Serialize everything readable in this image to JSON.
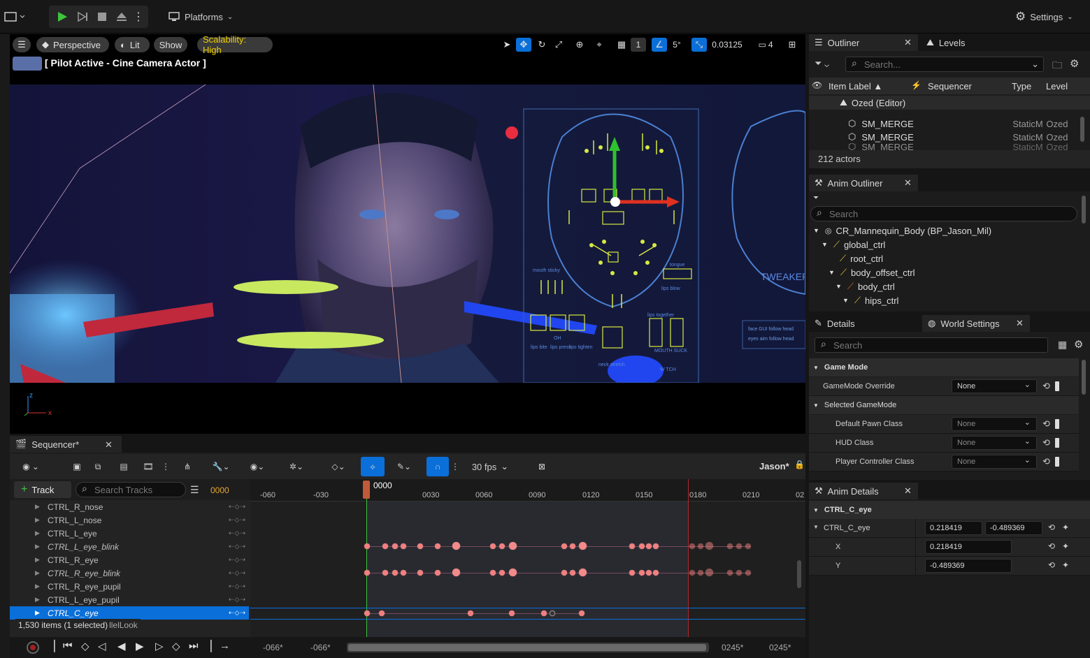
{
  "topbar": {
    "platforms_label": "Platforms",
    "settings_label": "Settings"
  },
  "viewport": {
    "perspective_label": "Perspective",
    "lit_label": "Lit",
    "show_label": "Show",
    "scalability_label": "Scalability: High",
    "grid_value": "1",
    "angle_value": "5°",
    "scale_value": "0.03125",
    "camera_speed": "4",
    "pilot_label": "[ Pilot Active - Cine Camera Actor ]",
    "axis_z": "z",
    "axis_x": "x",
    "board_labels": {
      "mouth_sticky": "mouth sticky",
      "lips_blow": "lips blow",
      "oh": "OH",
      "lips_together": "lips together",
      "mouth_suck": "MOUTH SUCK",
      "lips_bite": "lips bite",
      "lips_press": "lips press",
      "lips_tighten": "lips tighten",
      "neck_stretch": "neck stretch",
      "w_tch": "W TCH",
      "tongue": "tongue",
      "tweaker": "TWEAKER",
      "face_gui_follow": "face GUI follow head",
      "eyes_aim_follow": "eyes aim follow head"
    }
  },
  "outliner": {
    "tab_label": "Outliner",
    "levels_tab": "Levels",
    "search_placeholder": "Search...",
    "columns": [
      "Item Label ▲",
      "Sequencer",
      "Type",
      "Level"
    ],
    "root_item": "Ozed (Editor)",
    "items": [
      {
        "label": "SM_MERGE",
        "type": "StaticM",
        "level": "Ozed"
      },
      {
        "label": "SM_MERGE",
        "type": "StaticM",
        "level": "Ozed"
      },
      {
        "label": "SM_MERGE",
        "type": "StaticM",
        "level": "Ozed"
      }
    ],
    "actor_count": "212 actors"
  },
  "anim_outliner": {
    "tab_label": "Anim Outliner",
    "search_placeholder": "Search",
    "items": [
      {
        "label": "CR_Mannequin_Body  (BP_Jason_Mil)"
      },
      {
        "label": "global_ctrl"
      },
      {
        "label": "root_ctrl"
      },
      {
        "label": "body_offset_ctrl"
      },
      {
        "label": "body_ctrl"
      },
      {
        "label": "hips_ctrl"
      }
    ]
  },
  "details": {
    "tab_label": "Details",
    "world_settings_tab": "World Settings",
    "search_placeholder": "Search",
    "section_game_mode": "Game Mode",
    "gamemode_override_label": "GameMode Override",
    "gamemode_override_value": "None",
    "section_selected_gamemode": "Selected GameMode",
    "props": [
      {
        "label": "Default Pawn Class",
        "value": "None"
      },
      {
        "label": "HUD Class",
        "value": "None"
      },
      {
        "label": "Player Controller Class",
        "value": "None"
      }
    ]
  },
  "anim_details": {
    "tab_label": "Anim Details",
    "section": "CTRL_C_eye",
    "control_label": "CTRL_C_eye",
    "x_value": "0.218419",
    "y_value": "-0.489369",
    "x_label": "X",
    "y_label": "Y"
  },
  "sequencer": {
    "tab_label": "Sequencer*",
    "fps_label": "30 fps",
    "owner_label": "Jason*",
    "add_track_label": "Track",
    "search_placeholder": "Search Tracks",
    "current_frame": "0000",
    "playhead_label": "0000",
    "ruler_labels": [
      "-060",
      "-030",
      "0030",
      "0060",
      "0090",
      "0120",
      "0150",
      "0180",
      "0210",
      "02"
    ],
    "tracks": [
      {
        "name": "CTRL_R_nose",
        "italic": false
      },
      {
        "name": "CTRL_L_nose",
        "italic": false
      },
      {
        "name": "CTRL_L_eye",
        "italic": false
      },
      {
        "name": "CTRL_L_eye_blink",
        "italic": true
      },
      {
        "name": "CTRL_R_eye",
        "italic": false
      },
      {
        "name": "CTRL_R_eye_blink",
        "italic": true
      },
      {
        "name": "CTRL_R_eye_pupil",
        "italic": false
      },
      {
        "name": "CTRL_L_eye_pupil",
        "italic": false
      },
      {
        "name": "CTRL_C_eye",
        "italic": true,
        "selected": true
      }
    ],
    "status_text": "1,530 items (1 selected)",
    "status_suffix": "llelLook",
    "range_start_a": "-066*",
    "range_start_b": "-066*",
    "range_end_a": "0245*",
    "range_end_b": "0245*"
  },
  "colors": {
    "accent_blue": "#0a6fd9",
    "scalability_yellow": "#f0d000",
    "key_red": "#f08080",
    "play_green": "#3ec43e"
  }
}
